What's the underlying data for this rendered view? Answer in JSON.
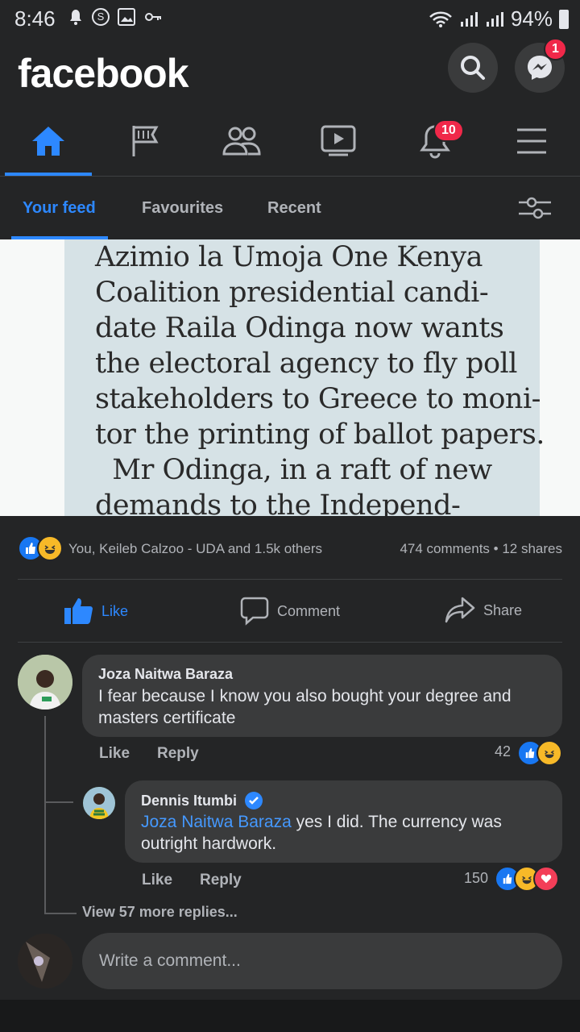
{
  "status_bar": {
    "time": "8:46",
    "icons": [
      "notification-icon",
      "skype-icon",
      "image-icon",
      "key-icon"
    ],
    "battery": "94%"
  },
  "header": {
    "logo": "facebook",
    "messenger_badge": "1"
  },
  "nav": {
    "items": [
      "home-icon",
      "pages-flag-icon",
      "groups-icon",
      "watch-icon",
      "notifications-bell-icon",
      "menu-icon"
    ],
    "notifications_badge": "10",
    "active": "home"
  },
  "feed_tabs": {
    "tabs": [
      "Your feed",
      "Favourites",
      "Recent"
    ],
    "active": "Your feed"
  },
  "post": {
    "image_text": "Azimio la Umoja One Kenya\nCoalition presidential candi-\ndate Raila Odinga now wants\nthe electoral agency to fly poll\nstakeholders to Greece to moni-\ntor the printing of ballot papers.\n  Mr Odinga, in a raft of new\ndemands to the Independ-",
    "reactions_text": "You, Keileb Calzoo - UDA and 1.5k others",
    "comments_shares": "474 comments • 12 shares",
    "actions": {
      "like": "Like",
      "comment": "Comment",
      "share": "Share"
    }
  },
  "comments": [
    {
      "author": "Joza Naitwa Baraza",
      "text": "I fear because I know you also bought your degree and masters certificate",
      "like": "Like",
      "reply": "Reply",
      "reaction_count": "42"
    },
    {
      "author": "Dennis Itumbi",
      "tag": "Joza Naitwa Baraza",
      "text": " yes I did. The currency was outright hardwork.",
      "like": "Like",
      "reply": "Reply",
      "reaction_count": "150"
    }
  ],
  "view_more": "View 57 more replies...",
  "write_comment_placeholder": "Write a comment...",
  "colors": {
    "accent": "#2d88ff",
    "background": "#18191a",
    "surface": "#242526",
    "bubble": "#3a3b3c",
    "badge": "#f02849"
  }
}
